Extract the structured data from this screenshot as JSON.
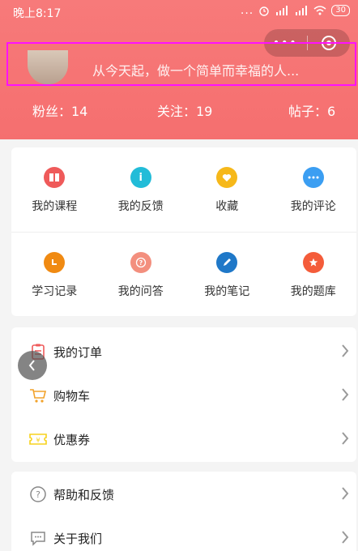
{
  "status_bar": {
    "time": "晚上8:17",
    "dots": "...",
    "battery": "30"
  },
  "profile": {
    "motto": "从今天起，做一个简单而幸福的人..."
  },
  "stats": {
    "fans": "粉丝：14",
    "following": "关注：19",
    "posts": "帖子：6"
  },
  "grid": [
    {
      "label": "我的课程",
      "icon": "book-icon",
      "color": "#ef5a5a"
    },
    {
      "label": "我的反馈",
      "icon": "info-icon",
      "color": "#22bcd8"
    },
    {
      "label": "收藏",
      "icon": "heart-icon",
      "color": "#f6b81a"
    },
    {
      "label": "我的评论",
      "icon": "comment-dots-icon",
      "color": "#3b9ef2"
    },
    {
      "label": "学习记录",
      "icon": "clock-icon",
      "color": "#f08a12"
    },
    {
      "label": "我的问答",
      "icon": "question-icon",
      "color": "#f38f7e"
    },
    {
      "label": "我的笔记",
      "icon": "pencil-icon",
      "color": "#1f78c8"
    },
    {
      "label": "我的题库",
      "icon": "star-icon",
      "color": "#f45c3a"
    }
  ],
  "list1": [
    {
      "label": "我的订单",
      "icon": "clipboard-icon"
    },
    {
      "label": "购物车",
      "icon": "cart-icon"
    },
    {
      "label": "优惠券",
      "icon": "coupon-icon"
    }
  ],
  "list2": [
    {
      "label": "帮助和反馈",
      "icon": "help-icon"
    },
    {
      "label": "关于我们",
      "icon": "chat-icon"
    }
  ],
  "colors": {
    "header": "#f56f6f",
    "accent_orange": "#f2a22a",
    "coupon_yellow": "#f7d21d"
  }
}
